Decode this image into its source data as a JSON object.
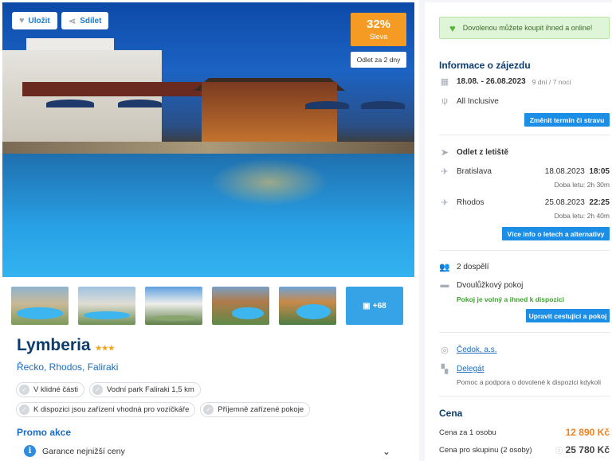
{
  "hero": {
    "save_label": "Uložit",
    "share_label": "Sdílet",
    "discount_pct": "32%",
    "discount_label": "Sleva",
    "departure_label": "Odlet za 2 dny"
  },
  "gallery": {
    "more_label": "+68"
  },
  "hotel": {
    "name": "Lymberia",
    "stars": "★★★",
    "location": "Řecko, Rhodos, Faliraki",
    "tags": [
      "V klidné části",
      "Vodní park Faliraki 1,5 km",
      "K dispozici jsou zařízení vhodná pro vozíčkáře",
      "Příjemně zařízené pokoje"
    ]
  },
  "promo": {
    "title": "Promo akce",
    "guarantee": "Garance nejnižší ceny"
  },
  "sidebar": {
    "banner": "Dovolenou můžete koupit ihned a online!",
    "info_title": "Informace o zájezdu",
    "dates": "18.08. - 26.08.2023",
    "duration": "9 dní / 7 nocí",
    "board": "All Inclusive",
    "change_btn": "Změnit termín či stravu",
    "departure_title": "Odlet z letiště",
    "out_city": "Bratislava",
    "out_date": "18.08.2023",
    "out_time": "18:05",
    "out_duration": "Doba letu: 2h 30m",
    "back_city": "Rhodos",
    "back_date": "25.08.2023",
    "back_time": "22:25",
    "back_duration": "Doba letu: 2h 40m",
    "flights_btn": "Více info o letech a alternativy",
    "travelers": "2 dospělí",
    "room": "Dvoulůžkový pokoj",
    "room_status": "Pokoj je volný a ihned k dispozici",
    "edit_btn": "Upravit cestující a pokoj",
    "agency": "Čedok, a.s.",
    "delegate": "Delegát",
    "delegate_note": "Pomoc a podpora o dovolené k dispozici kdykoli",
    "price_title": "Cena",
    "price_person_label": "Cena za 1 osobu",
    "price_person": "12 890 Kč",
    "price_group_label": "Cena pro skupinu (2 osoby)",
    "price_group": "25 780 Kč",
    "accent": "#1d8ee6",
    "discount_color": "#f59b23"
  }
}
